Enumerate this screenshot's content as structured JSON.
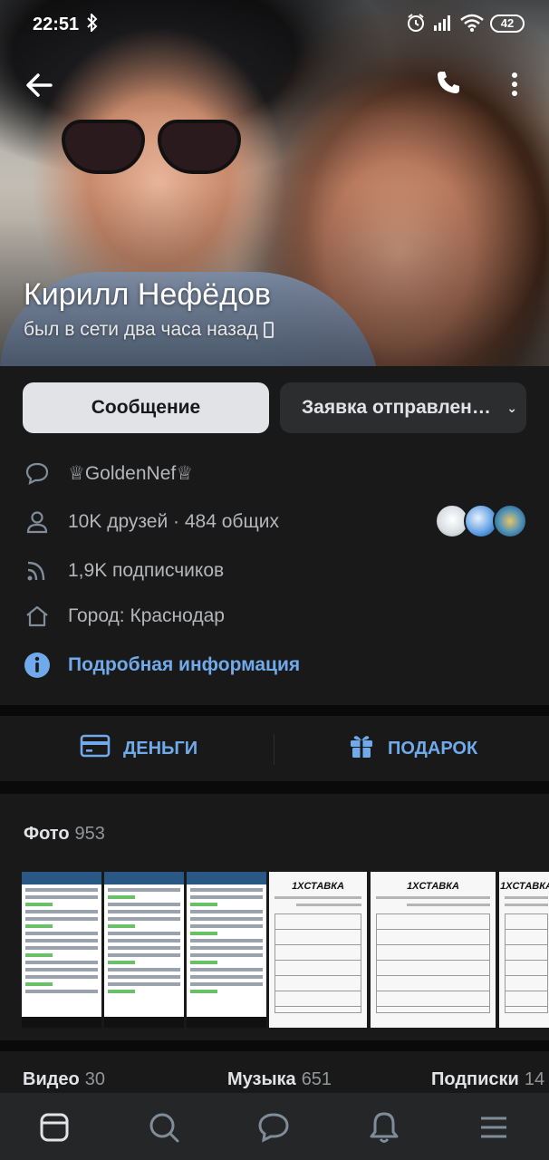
{
  "status_bar": {
    "time": "22:51",
    "battery": "42"
  },
  "profile": {
    "name": "Кирилл Нефёдов",
    "last_seen": "был в сети два часа назад"
  },
  "buttons": {
    "message": "Сообщение",
    "request": "Заявка отправлен…"
  },
  "info": {
    "status": "♕GoldenNef♕",
    "friends": "10K друзей · 484 общих",
    "followers": "1,9K подписчиков",
    "city": "Город: Краснодар",
    "details": "Подробная информация"
  },
  "actions": {
    "money": "ДЕНЬГИ",
    "gift": "ПОДАРОК"
  },
  "photos": {
    "label": "Фото",
    "count": "953"
  },
  "tabs": [
    {
      "label": "Видео",
      "count": "30"
    },
    {
      "label": "Музыка",
      "count": "651"
    },
    {
      "label": "Подписки",
      "count": "14"
    }
  ],
  "colors": {
    "accent": "#71aaeb",
    "background": "#19191a",
    "button_primary": "#e1e3e6",
    "button_secondary": "#2c2d2e"
  },
  "icons": [
    "back-arrow-icon",
    "phone-icon",
    "more-icon",
    "message-bubble-icon",
    "user-icon",
    "rss-icon",
    "home-icon",
    "info-icon",
    "card-icon",
    "gift-icon",
    "news-icon",
    "search-icon",
    "messages-icon",
    "bell-icon",
    "menu-icon"
  ]
}
